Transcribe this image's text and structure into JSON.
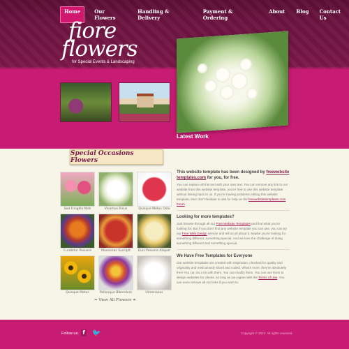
{
  "nav": {
    "items": [
      "Home",
      "Our Flowers",
      "Handling & Delivery",
      "Payment & Ordering",
      "About",
      "Blog",
      "Contact Us"
    ],
    "active": "Home"
  },
  "logo": {
    "line1": "fiore",
    "line2": "flowers",
    "tagline": "for Special Events & Landscaping"
  },
  "latest": "Latest Work",
  "section_title": "Special Occasions Flowers",
  "products": [
    {
      "name": "Sed Fringilla Nish",
      "color": "#d9577f"
    },
    {
      "name": "Vivamus Risus",
      "color": "#eef0e0"
    },
    {
      "name": "Quisque Metus Odio",
      "color": "#c41f3a"
    },
    {
      "name": "Curabitur Posuere",
      "color": "#d45a1a"
    },
    {
      "name": "Maecenas Suscipit",
      "color": "#b5302d"
    },
    {
      "name": "Duis Posuere Aliquet",
      "color": "#e8d8a2"
    },
    {
      "name": "Quisque Metus",
      "color": "#e8b318"
    },
    {
      "name": "Pellenque Bibendum",
      "color": "#d26a3a"
    },
    {
      "name": "Himenaeos",
      "color": "#f0ece8"
    }
  ],
  "view_all": "View All Flowers",
  "content": {
    "b1_title": "This website template has been designed by",
    "b1_link": "freewebsite templates.com",
    "b1_title_end": "for you, for free.",
    "b1_text": "You can replace all this text with your own text. You can remove any link to our website from this website template, you're free to use this website template without linking back to us. If you're having problems editing this website template, then don't hesitate to ask for help on the",
    "b1_help_link": "freewebsitetemplates.com forum",
    "b2_title": "Looking for more templates?",
    "b2_text1": "Just browse through all our",
    "b2_link1": "Free Website Templates",
    "b2_text2": "and find what you're looking for. But if you don't find any website template you can use, you can try our",
    "b2_link2": "Free Web Design",
    "b2_text3": "service and tell us all about it. Maybe you're looking for something different, something special. And we love the challenge of doing something different and something special.",
    "b3_title": "We Have Free Templates for Everyone",
    "b3_text1": "Our website templates are created with inspiration, checked for quality and originality and meticulously sliced and coded. What's more, they're absolutely free! You can do a lot with them. You can modify them. You can use them to design websites for clients, so long as you agree with the",
    "b3_link": "Terms of Use",
    "b3_text2": ". You can even remove all our links if you want to."
  },
  "footer": {
    "follow": "Follow us:",
    "copyright": "Copyright © 2012. All rights reserved."
  },
  "colors": {
    "brand": "#c81c74",
    "header_dark": "#6b1440",
    "ribbon": "#f5e7c6"
  }
}
